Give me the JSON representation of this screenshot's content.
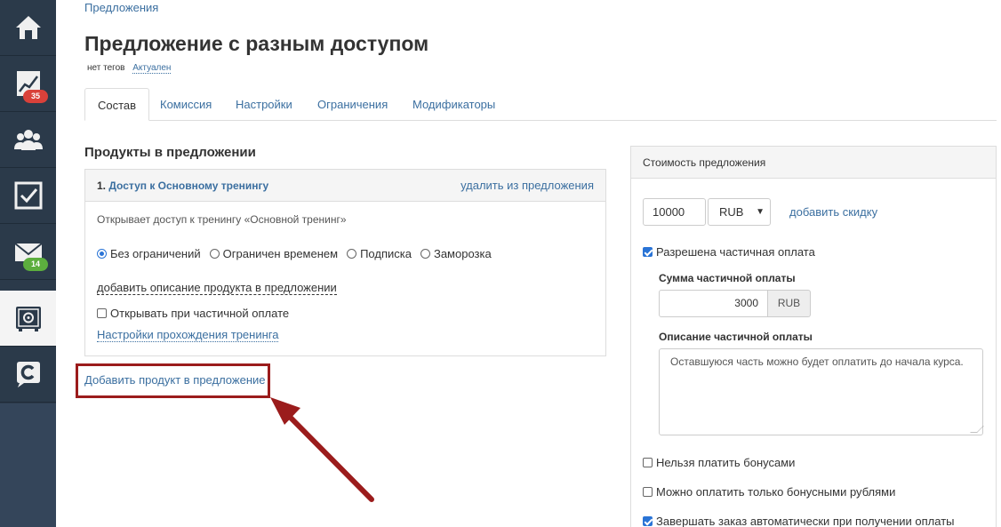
{
  "sidebar": {
    "items": [
      {
        "icon": "home-icon"
      },
      {
        "icon": "chart-icon",
        "badge": "35",
        "badge_color": "#d9413a"
      },
      {
        "icon": "users-icon"
      },
      {
        "icon": "tasks-icon"
      },
      {
        "icon": "mail-icon",
        "badge": "14",
        "badge_color": "#5cae3e"
      },
      {
        "icon": "safe-icon",
        "active": true
      },
      {
        "icon": "brand-c-icon"
      }
    ]
  },
  "breadcrumb": "Предложения",
  "page_title": "Предложение с разным доступом",
  "tags": {
    "label": "нет тегов",
    "status": "Актуален"
  },
  "tabs": [
    {
      "label": "Состав",
      "active": true
    },
    {
      "label": "Комиссия"
    },
    {
      "label": "Настройки"
    },
    {
      "label": "Ограничения"
    },
    {
      "label": "Модификаторы"
    }
  ],
  "products": {
    "title": "Продукты в предложении",
    "item": {
      "number": "1.",
      "name": "Доступ к Основному тренингу",
      "remove_label": "удалить из предложения",
      "description": "Открывает доступ к тренингу «Основной тренинг»",
      "access_options": [
        {
          "label": "Без ограничений",
          "selected": true
        },
        {
          "label": "Ограничен временем"
        },
        {
          "label": "Подписка"
        },
        {
          "label": "Заморозка"
        }
      ],
      "add_description_label": "добавить описание продукта в предложении",
      "open_on_partial_label": "Открывать при частичной оплате",
      "open_on_partial_checked": false,
      "training_settings_label": "Настройки прохождения тренинга"
    },
    "add_product_label": "Добавить продукт в предложение"
  },
  "price_panel": {
    "title": "Стоимость предложения",
    "price_value": "10000",
    "currency": "RUB",
    "add_discount_label": "добавить скидку",
    "partial_allowed_label": "Разрешена частичная оплата",
    "partial_allowed_checked": true,
    "partial_sum_label": "Сумма частичной оплаты",
    "partial_sum_value": "3000",
    "partial_sum_currency": "RUB",
    "partial_desc_label": "Описание частичной оплаты",
    "partial_desc_value": "Оставшуюся часть можно будет оплатить до начала курса.",
    "no_bonus_label": "Нельзя платить бонусами",
    "no_bonus_checked": false,
    "bonus_only_label": "Можно оплатить только бонусными рублями",
    "bonus_only_checked": false,
    "auto_complete_label": "Завершать заказ автоматически при получении оплаты",
    "auto_complete_checked": true
  },
  "colors": {
    "sidebar_bg": "#2b3a4a",
    "link": "#3b6fa0",
    "highlight_frame": "#9b1c1c",
    "arrow": "#9b1c1c"
  }
}
